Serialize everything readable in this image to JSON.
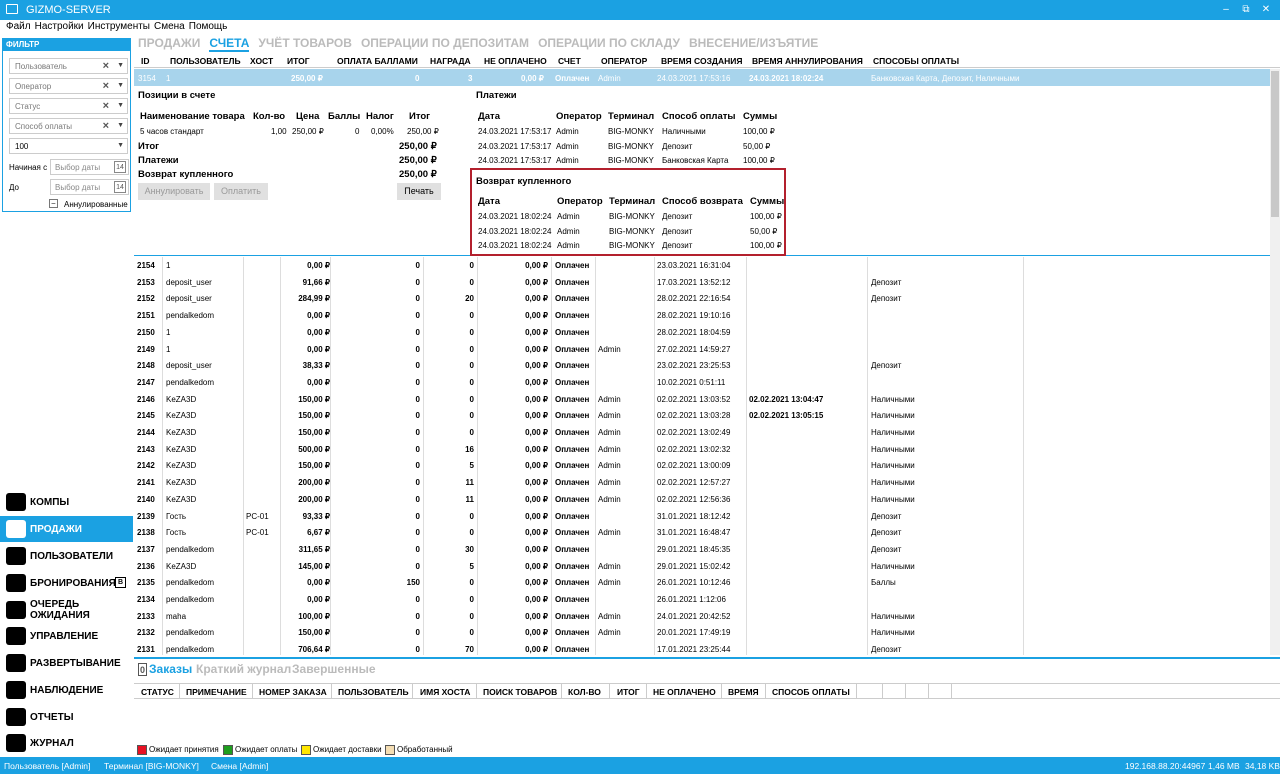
{
  "window": {
    "title": "GIZMO-SERVER"
  },
  "menu": [
    "Файл",
    "Настройки",
    "Инструменты",
    "Смена",
    "Помощь"
  ],
  "filter": {
    "title": "ФИЛЬТР",
    "user_placeholder": "Пользователь",
    "operator_placeholder": "Оператор",
    "status_placeholder": "Статус",
    "paymethod_placeholder": "Способ оплаты",
    "limit_value": "100",
    "start_label": "Начиная с",
    "end_label": "До",
    "date_placeholder": "Выбор даты",
    "calendar_glyph": "14",
    "annulled_label": "Аннулированные"
  },
  "sidebar": [
    {
      "label": "КОМПЫ",
      "icon": "monitor-icon"
    },
    {
      "label": "ПРОДАЖИ",
      "icon": "shopping-bag-icon",
      "active": true
    },
    {
      "label": "ПОЛЬЗОВАТЕЛИ",
      "icon": "users-icon"
    },
    {
      "label": "БРОНИРОВАНИЯ",
      "icon": "calendar-icon",
      "badge": "B"
    },
    {
      "label": "ОЧЕРЕДЬ ОЖИДАНИЯ",
      "icon": "queue-icon"
    },
    {
      "label": "УПРАВЛЕНИЕ",
      "icon": "gear-icon"
    },
    {
      "label": "РАЗВЕРТЫВАНИЕ",
      "icon": "disk-icon"
    },
    {
      "label": "НАБЛЮДЕНИЕ",
      "icon": "monitor-play-icon"
    },
    {
      "label": "ОТЧЕТЫ",
      "icon": "pie-chart-icon"
    },
    {
      "label": "ЖУРНАЛ",
      "icon": "list-icon"
    }
  ],
  "top_tabs": [
    {
      "label": "ПРОДАЖИ"
    },
    {
      "label": "СЧЕТА",
      "active": true
    },
    {
      "label": "УЧЁТ ТОВАРОВ"
    },
    {
      "label": "ОПЕРАЦИИ ПО ДЕПОЗИТАМ"
    },
    {
      "label": "ОПЕРАЦИИ ПО СКЛАДУ"
    },
    {
      "label": "ВНЕСЕНИЕ/ИЗЪЯТИЕ"
    }
  ],
  "columns": [
    "ID",
    "ПОЛЬЗОВАТЕЛЬ",
    "ХОСТ",
    "ИТОГ",
    "ОПЛАТА БАЛЛАМИ",
    "НАГРАДА",
    "НЕ ОПЛАЧЕНО",
    "СЧЕТ",
    "ОПЕРАТОР",
    "ВРЕМЯ СОЗДАНИЯ",
    "ВРЕМЯ АННУЛИРОВАНИЯ",
    "СПОСОБЫ ОПЛАТЫ"
  ],
  "selected_row": {
    "id": "3154",
    "user": "1",
    "host": "",
    "total": "250,00 ₽",
    "points": "0",
    "reward": "3",
    "unpaid": "0,00 ₽",
    "status": "Оплачен",
    "operator": "Admin",
    "created": "24.03.2021 17:53:16",
    "annulled": "24.03.2021 18:02:24",
    "methods": "Банковская Карта, Депозит, Наличными"
  },
  "details": {
    "items_title": "Позиции в счете",
    "items_headers": [
      "Наименование товара",
      "Кол-во",
      "Цена",
      "Баллы",
      "Налог",
      "Итог"
    ],
    "items": [
      {
        "name": "5 часов стандарт",
        "qty": "1,00",
        "price": "250,00 ₽",
        "points": "0",
        "tax": "0,00%",
        "total": "250,00 ₽"
      }
    ],
    "total_label": "Итог",
    "total_value": "250,00 ₽",
    "payments_label": "Платежи",
    "payments_value": "250,00 ₽",
    "refund_label": "Возврат купленного",
    "refund_value": "250,00 ₽",
    "annul_btn": "Аннулировать",
    "pay_btn": "Оплатить",
    "print_btn": "Печать",
    "payments_title": "Платежи",
    "payments_headers": [
      "Дата",
      "Оператор",
      "Терминал",
      "Способ оплаты",
      "Суммы"
    ],
    "payments": [
      {
        "date": "24.03.2021 17:53:17",
        "operator": "Admin",
        "terminal": "BIG-MONKY",
        "method": "Наличными",
        "sum": "100,00 ₽"
      },
      {
        "date": "24.03.2021 17:53:17",
        "operator": "Admin",
        "terminal": "BIG-MONKY",
        "method": "Депозит",
        "sum": "50,00 ₽"
      },
      {
        "date": "24.03.2021 17:53:17",
        "operator": "Admin",
        "terminal": "BIG-MONKY",
        "method": "Банковская Карта",
        "sum": "100,00 ₽"
      }
    ],
    "refunds_title": "Возврат купленного",
    "refunds_headers": [
      "Дата",
      "Оператор",
      "Терминал",
      "Способ возврата",
      "Суммы"
    ],
    "refunds": [
      {
        "date": "24.03.2021 18:02:24",
        "operator": "Admin",
        "terminal": "BIG-MONKY",
        "method": "Депозит",
        "sum": "100,00 ₽"
      },
      {
        "date": "24.03.2021 18:02:24",
        "operator": "Admin",
        "terminal": "BIG-MONKY",
        "method": "Депозит",
        "sum": "50,00 ₽"
      },
      {
        "date": "24.03.2021 18:02:24",
        "operator": "Admin",
        "terminal": "BIG-MONKY",
        "method": "Депозит",
        "sum": "100,00 ₽"
      }
    ]
  },
  "rows": [
    [
      "2154",
      "1",
      "",
      "0,00 ₽",
      "0",
      "0",
      "0,00 ₽",
      "Оплачен",
      "",
      "23.03.2021 16:31:04",
      "",
      ""
    ],
    [
      "2153",
      "deposit_user",
      "",
      "91,66 ₽",
      "0",
      "0",
      "0,00 ₽",
      "Оплачен",
      "",
      "17.03.2021 13:52:12",
      "",
      "Депозит"
    ],
    [
      "2152",
      "deposit_user",
      "",
      "284,99 ₽",
      "0",
      "20",
      "0,00 ₽",
      "Оплачен",
      "",
      "28.02.2021 22:16:54",
      "",
      "Депозит"
    ],
    [
      "2151",
      "pendalkedom",
      "",
      "0,00 ₽",
      "0",
      "0",
      "0,00 ₽",
      "Оплачен",
      "",
      "28.02.2021 19:10:16",
      "",
      ""
    ],
    [
      "2150",
      "1",
      "",
      "0,00 ₽",
      "0",
      "0",
      "0,00 ₽",
      "Оплачен",
      "",
      "28.02.2021 18:04:59",
      "",
      ""
    ],
    [
      "2149",
      "1",
      "",
      "0,00 ₽",
      "0",
      "0",
      "0,00 ₽",
      "Оплачен",
      "Admin",
      "27.02.2021 14:59:27",
      "",
      ""
    ],
    [
      "2148",
      "deposit_user",
      "",
      "38,33 ₽",
      "0",
      "0",
      "0,00 ₽",
      "Оплачен",
      "",
      "23.02.2021 23:25:53",
      "",
      "Депозит"
    ],
    [
      "2147",
      "pendalkedom",
      "",
      "0,00 ₽",
      "0",
      "0",
      "0,00 ₽",
      "Оплачен",
      "",
      "10.02.2021 0:51:11",
      "",
      ""
    ],
    [
      "2146",
      "KeZA3D",
      "",
      "150,00 ₽",
      "0",
      "0",
      "0,00 ₽",
      "Оплачен",
      "Admin",
      "02.02.2021 13:03:52",
      "02.02.2021 13:04:47",
      "Наличными"
    ],
    [
      "2145",
      "KeZA3D",
      "",
      "150,00 ₽",
      "0",
      "0",
      "0,00 ₽",
      "Оплачен",
      "Admin",
      "02.02.2021 13:03:28",
      "02.02.2021 13:05:15",
      "Наличными"
    ],
    [
      "2144",
      "KeZA3D",
      "",
      "150,00 ₽",
      "0",
      "0",
      "0,00 ₽",
      "Оплачен",
      "Admin",
      "02.02.2021 13:02:49",
      "",
      "Наличными"
    ],
    [
      "2143",
      "KeZA3D",
      "",
      "500,00 ₽",
      "0",
      "16",
      "0,00 ₽",
      "Оплачен",
      "Admin",
      "02.02.2021 13:02:32",
      "",
      "Наличными"
    ],
    [
      "2142",
      "KeZA3D",
      "",
      "150,00 ₽",
      "0",
      "5",
      "0,00 ₽",
      "Оплачен",
      "Admin",
      "02.02.2021 13:00:09",
      "",
      "Наличными"
    ],
    [
      "2141",
      "KeZA3D",
      "",
      "200,00 ₽",
      "0",
      "11",
      "0,00 ₽",
      "Оплачен",
      "Admin",
      "02.02.2021 12:57:27",
      "",
      "Наличными"
    ],
    [
      "2140",
      "KeZA3D",
      "",
      "200,00 ₽",
      "0",
      "11",
      "0,00 ₽",
      "Оплачен",
      "Admin",
      "02.02.2021 12:56:36",
      "",
      "Наличными"
    ],
    [
      "2139",
      "Гость",
      "PC-01",
      "93,33 ₽",
      "0",
      "0",
      "0,00 ₽",
      "Оплачен",
      "",
      "31.01.2021 18:12:42",
      "",
      "Депозит"
    ],
    [
      "2138",
      "Гость",
      "PC-01",
      "6,67 ₽",
      "0",
      "0",
      "0,00 ₽",
      "Оплачен",
      "Admin",
      "31.01.2021 16:48:47",
      "",
      "Депозит"
    ],
    [
      "2137",
      "pendalkedom",
      "",
      "311,65 ₽",
      "0",
      "30",
      "0,00 ₽",
      "Оплачен",
      "",
      "29.01.2021 18:45:35",
      "",
      "Депозит"
    ],
    [
      "2136",
      "KeZA3D",
      "",
      "145,00 ₽",
      "0",
      "5",
      "0,00 ₽",
      "Оплачен",
      "Admin",
      "29.01.2021 15:02:42",
      "",
      "Наличными"
    ],
    [
      "2135",
      "pendalkedom",
      "",
      "0,00 ₽",
      "150",
      "0",
      "0,00 ₽",
      "Оплачен",
      "Admin",
      "26.01.2021 10:12:46",
      "",
      "Баллы"
    ],
    [
      "2134",
      "pendalkedom",
      "",
      "0,00 ₽",
      "0",
      "0",
      "0,00 ₽",
      "Оплачен",
      "",
      "26.01.2021 1:12:06",
      "",
      ""
    ],
    [
      "2133",
      "maha",
      "",
      "100,00 ₽",
      "0",
      "0",
      "0,00 ₽",
      "Оплачен",
      "Admin",
      "24.01.2021 20:42:52",
      "",
      "Наличными"
    ],
    [
      "2132",
      "pendalkedom",
      "",
      "150,00 ₽",
      "0",
      "0",
      "0,00 ₽",
      "Оплачен",
      "Admin",
      "20.01.2021 17:49:19",
      "",
      "Наличными"
    ],
    [
      "2131",
      "pendalkedom",
      "",
      "706,64 ₽",
      "0",
      "70",
      "0,00 ₽",
      "Оплачен",
      "",
      "17.01.2021 23:25:44",
      "",
      "Депозит"
    ]
  ],
  "bottom": {
    "count_badge": "0",
    "tabs": [
      {
        "label": "Заказы",
        "active": true
      },
      {
        "label": "Краткий журнал"
      },
      {
        "label": "Завершенные"
      }
    ],
    "columns": [
      "СТАТУС",
      "ПРИМЕЧАНИЕ",
      "НОМЕР ЗАКАЗА",
      "ПОЛЬЗОВАТЕЛЬ",
      "ИМЯ ХОСТА",
      "ПОИСК ТОВАРОВ",
      "КОЛ-ВО",
      "ИТОГ",
      "НЕ ОПЛАЧЕНО",
      "ВРЕМЯ",
      "СПОСОБ ОПЛАТЫ"
    ],
    "legend": [
      {
        "label": "Ожидает принятия",
        "color": "#e81123"
      },
      {
        "label": "Ожидает оплаты",
        "color": "#1e9e1e"
      },
      {
        "label": "Ожидает доставки",
        "color": "#ffe600"
      },
      {
        "label": "Обработанный",
        "color": "#f5deb3"
      }
    ]
  },
  "statusbar": {
    "user": "Пользователь [Admin]",
    "terminal": "Терминал [BIG-MONKY]",
    "shift": "Смена [Admin]",
    "address": "192.168.88.20:44967",
    "mem": "1,46 MB",
    "rate": "34,18 KB"
  }
}
